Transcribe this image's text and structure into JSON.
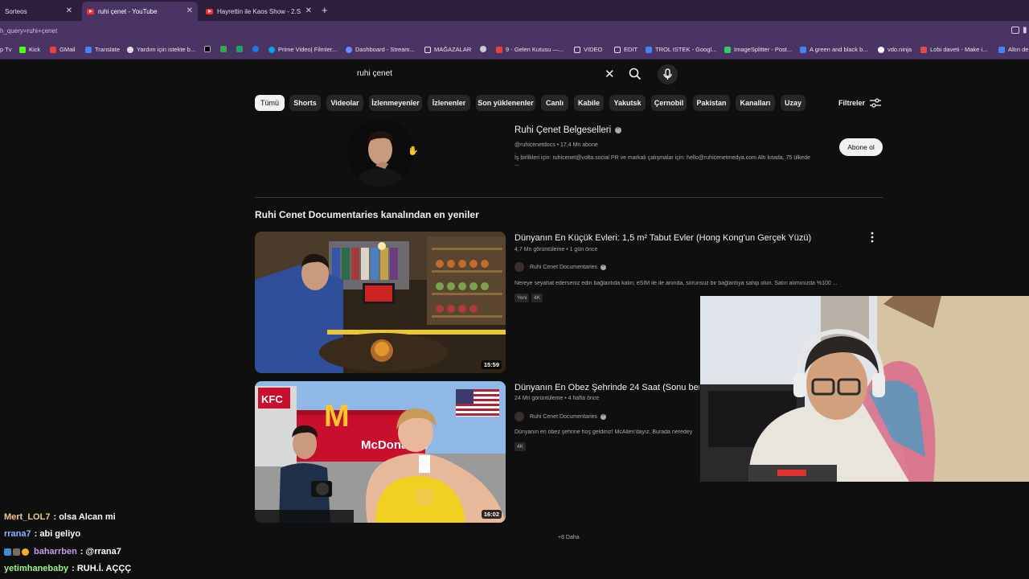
{
  "browser": {
    "tabs": [
      {
        "title": "Sorteos"
      },
      {
        "title": "ruhi çenet - YouTube"
      },
      {
        "title": "Hayrettin ile Kaos Show - 2.Sez"
      }
    ],
    "url": "h_query=ruhi+çenet",
    "bookmarks": [
      "p Tv",
      "Kick",
      "GMail",
      "Translate",
      "Yardım için istekte b...",
      "",
      "",
      "",
      "",
      "Prime Video| Filmler...",
      "Dashboard - Stream...",
      "MAĞAZALAR",
      "",
      "9 - Gelen Kutusu —...",
      "VIDEO",
      "EDIT",
      "TROL ISTEK - Googl...",
      "ImageSplitter - Post...",
      "A green and black b...",
      "vdo.ninja",
      "Lobi daveti - Make i...",
      "Altın de"
    ]
  },
  "search": {
    "query": "ruhi çenet"
  },
  "filters": {
    "chips": [
      "Tümü",
      "Shorts",
      "Videolar",
      "İzlenmeyenler",
      "İzlenenler",
      "Son yüklenenler",
      "Canlı",
      "Kabile",
      "Yakutsk",
      "Çernobil",
      "Pakistan",
      "Kanalları",
      "Uzay"
    ],
    "active": "Tümü",
    "filters_label": "Filtreler"
  },
  "channel": {
    "name": "Ruhi Çenet Belgeselleri",
    "meta": "@ruhicenetdocs • 17,4 Mn abone",
    "description": "İş birlikleri için: ruhicenet@volta.social PR ve markalı çalışmalar için: hello@ruhicenetmedya.com Altı kıtada, 75 ülkede",
    "description_more": "...",
    "subscribe_label": "Abone ol"
  },
  "section": {
    "title": "Ruhi Cenet Documentaries kanalından en yeniler"
  },
  "videos": [
    {
      "title": "Dünyanın En Küçük Evleri: 1,5 m² Tabut Evler (Hong Kong'un Gerçek Yüzü)",
      "meta": "4,7 Mn görüntüleme • 1 gün önce",
      "channel": "Ruhi Cenet Documentaries",
      "description": "Nereye seyahat ederseniz edin bağlantıda kalın; eSIM ile ile anında, sorunsuz bir bağlantıya sahip olun. Satın alımınızda %100 ...",
      "badges": [
        "Yeni",
        "4K"
      ],
      "duration": "15:59"
    },
    {
      "title": "Dünyanın En Obez Şehrinde 24 Saat (Sonu ben",
      "meta": "24 Mn görüntüleme • 4 hafta önce",
      "channel": "Ruhi Cenet Documentaries",
      "description": "Dünyanın en obez şehrine hoş geldiniz! McAllen'dayız. Burada neredey",
      "badges": [
        "4K"
      ],
      "duration": "16:02"
    }
  ],
  "more_label": "+8 Daha",
  "chat": [
    {
      "user": "Mert_LOL7",
      "message": ": olsa Alcan mi",
      "color": "#f0c98a"
    },
    {
      "user": "rrana7",
      "message": ": abi geliyo",
      "color": "#8fb4ff"
    },
    {
      "user": "baharrben",
      "message": ": @rrana7",
      "color": "#c79cf2"
    },
    {
      "user": "yetimhanebaby",
      "message": ": RUH.İ. AÇÇÇ",
      "color": "#9cf28f"
    }
  ],
  "thumb_text": {
    "brand1": "KFC",
    "brand2": "McDonald's"
  }
}
